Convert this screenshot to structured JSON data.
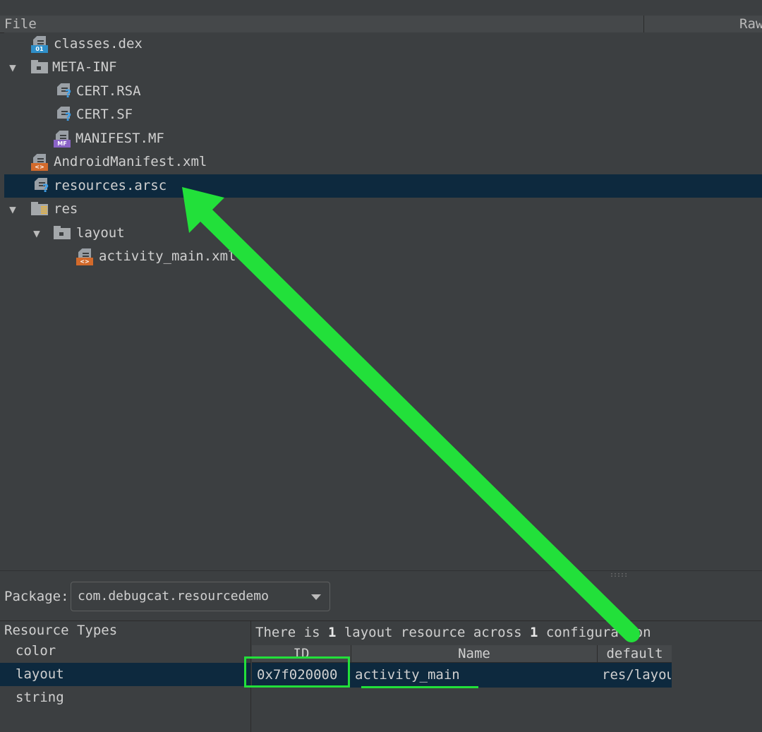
{
  "header": {
    "file_col": "File",
    "raw_col": "Raw"
  },
  "tree": {
    "rows": [
      {
        "label": "classes.dex",
        "icon": "dex-file-icon",
        "badge": "01"
      },
      {
        "label": "META-INF",
        "icon": "folder-icon",
        "expanded": true
      },
      {
        "label": "CERT.RSA",
        "icon": "unknown-file-icon"
      },
      {
        "label": "CERT.SF",
        "icon": "unknown-file-icon"
      },
      {
        "label": "MANIFEST.MF",
        "icon": "manifest-file-icon",
        "badge": "MF"
      },
      {
        "label": "AndroidManifest.xml",
        "icon": "xml-file-icon",
        "badge": "<>"
      },
      {
        "label": "resources.arsc",
        "icon": "unknown-file-icon",
        "selected": true
      },
      {
        "label": "res",
        "icon": "resource-folder-icon",
        "expanded": true
      },
      {
        "label": "layout",
        "icon": "folder-icon",
        "expanded": true
      },
      {
        "label": "activity_main.xml",
        "icon": "xml-file-icon",
        "badge": "<>"
      }
    ],
    "expand_arrow": "▼"
  },
  "package": {
    "label": "Package:",
    "value": "com.debugcat.resourcedemo"
  },
  "resource_types": {
    "header": "Resource Types",
    "items": [
      "color",
      "layout",
      "string"
    ],
    "selected": "layout"
  },
  "summary": {
    "prefix": "There is ",
    "count": "1",
    "middle": " layout resource across ",
    "config_count": "1",
    "suffix": " configuration"
  },
  "table": {
    "columns": [
      "ID",
      "Name",
      "default"
    ],
    "rows": [
      {
        "id": "0x7f020000",
        "name": "activity_main",
        "default": "res/layout/activity_main.xml"
      }
    ]
  },
  "colors": {
    "background": "#3c3f41",
    "selection": "#0d293e",
    "annotation": "#22e03a"
  }
}
